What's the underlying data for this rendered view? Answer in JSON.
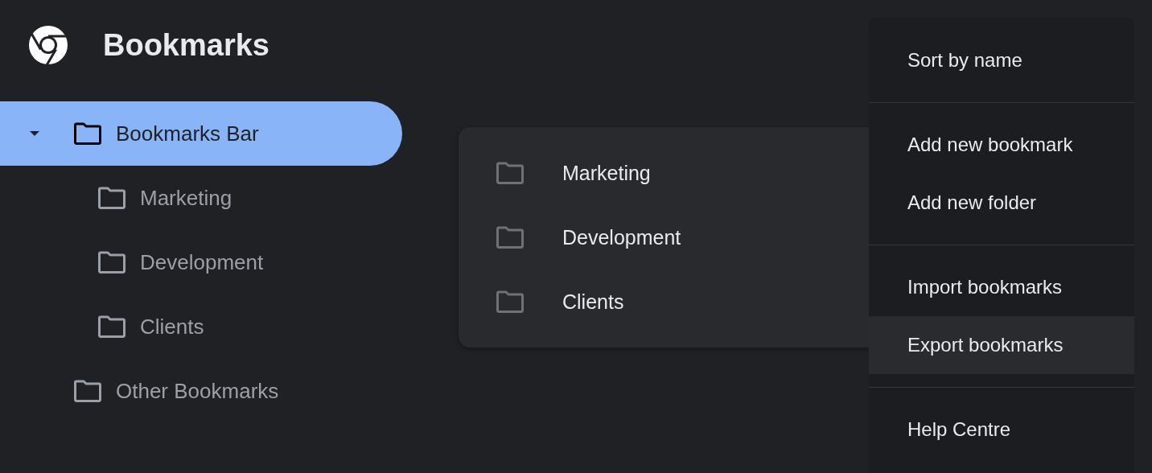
{
  "header": {
    "title": "Bookmarks"
  },
  "sidebar": {
    "tree": [
      {
        "label": "Bookmarks Bar",
        "selected": true,
        "expanded": true,
        "children": [
          {
            "label": "Marketing",
            "selected": false
          },
          {
            "label": "Development",
            "selected": false
          },
          {
            "label": "Clients",
            "selected": false
          }
        ]
      },
      {
        "label": "Other Bookmarks",
        "selected": false
      }
    ]
  },
  "list": {
    "items": [
      {
        "label": "Marketing"
      },
      {
        "label": "Development"
      },
      {
        "label": "Clients"
      }
    ]
  },
  "menu": {
    "groups": [
      {
        "items": [
          {
            "label": "Sort by name",
            "selected": false
          }
        ]
      },
      {
        "items": [
          {
            "label": "Add new bookmark",
            "selected": false
          },
          {
            "label": "Add new folder",
            "selected": false
          }
        ]
      },
      {
        "items": [
          {
            "label": "Import bookmarks",
            "selected": false
          },
          {
            "label": "Export bookmarks",
            "selected": true
          }
        ]
      },
      {
        "items": [
          {
            "label": "Help Centre",
            "selected": false
          }
        ]
      }
    ]
  }
}
